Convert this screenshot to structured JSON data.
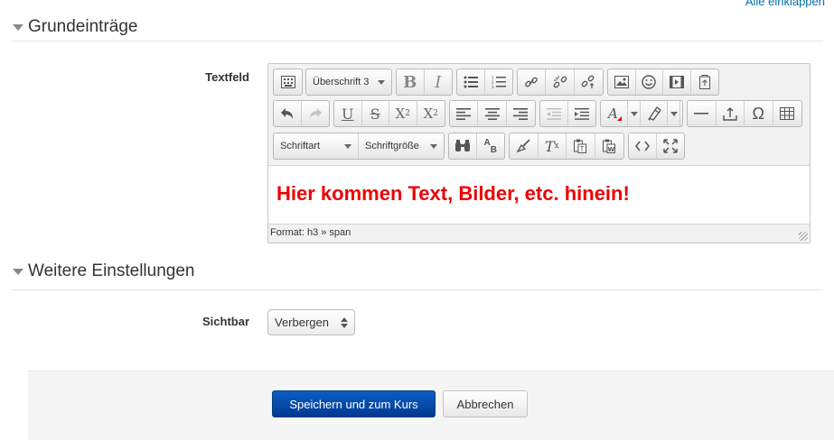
{
  "collapse_all": "Alle einklappen",
  "sections": {
    "general": {
      "title": "Grundeinträge"
    },
    "more": {
      "title": "Weitere Einstellungen"
    }
  },
  "fields": {
    "textfield": {
      "label": "Textfeld",
      "format_combo": "Überschrift 3",
      "font_combo": "Schriftart",
      "size_combo": "Schriftgröße",
      "content": "Hier kommen Text, Bilder, etc. hinein!",
      "content_color": "#ee0000",
      "statusbar": "Format: h3 » span",
      "toolbar_icons": [
        "toolbar-toggle-icon",
        "bold-icon",
        "italic-icon",
        "bullet-list-icon",
        "numbered-list-icon",
        "link-icon",
        "unlink-icon",
        "anchor-icon",
        "image-icon",
        "emoticon-icon",
        "media-icon",
        "file-icon",
        "undo-icon",
        "redo-icon",
        "underline-icon",
        "strikethrough-icon",
        "subscript-icon",
        "superscript-icon",
        "align-left-icon",
        "align-center-icon",
        "align-right-icon",
        "outdent-icon",
        "indent-icon",
        "text-color-icon",
        "background-color-icon",
        "horizontal-rule-icon",
        "upload-icon",
        "special-char-icon",
        "table-icon",
        "search-icon",
        "replace-icon",
        "cleanup-icon",
        "clear-format-icon",
        "paste-text-icon",
        "paste-word-icon",
        "html-icon",
        "fullscreen-icon"
      ]
    },
    "visible": {
      "label": "Sichtbar",
      "value": "Verbergen"
    }
  },
  "buttons": {
    "save": "Speichern und zum Kurs",
    "cancel": "Abbrechen"
  },
  "colors": {
    "primary_button": "#0a4fb0",
    "link": "#0070a8"
  }
}
